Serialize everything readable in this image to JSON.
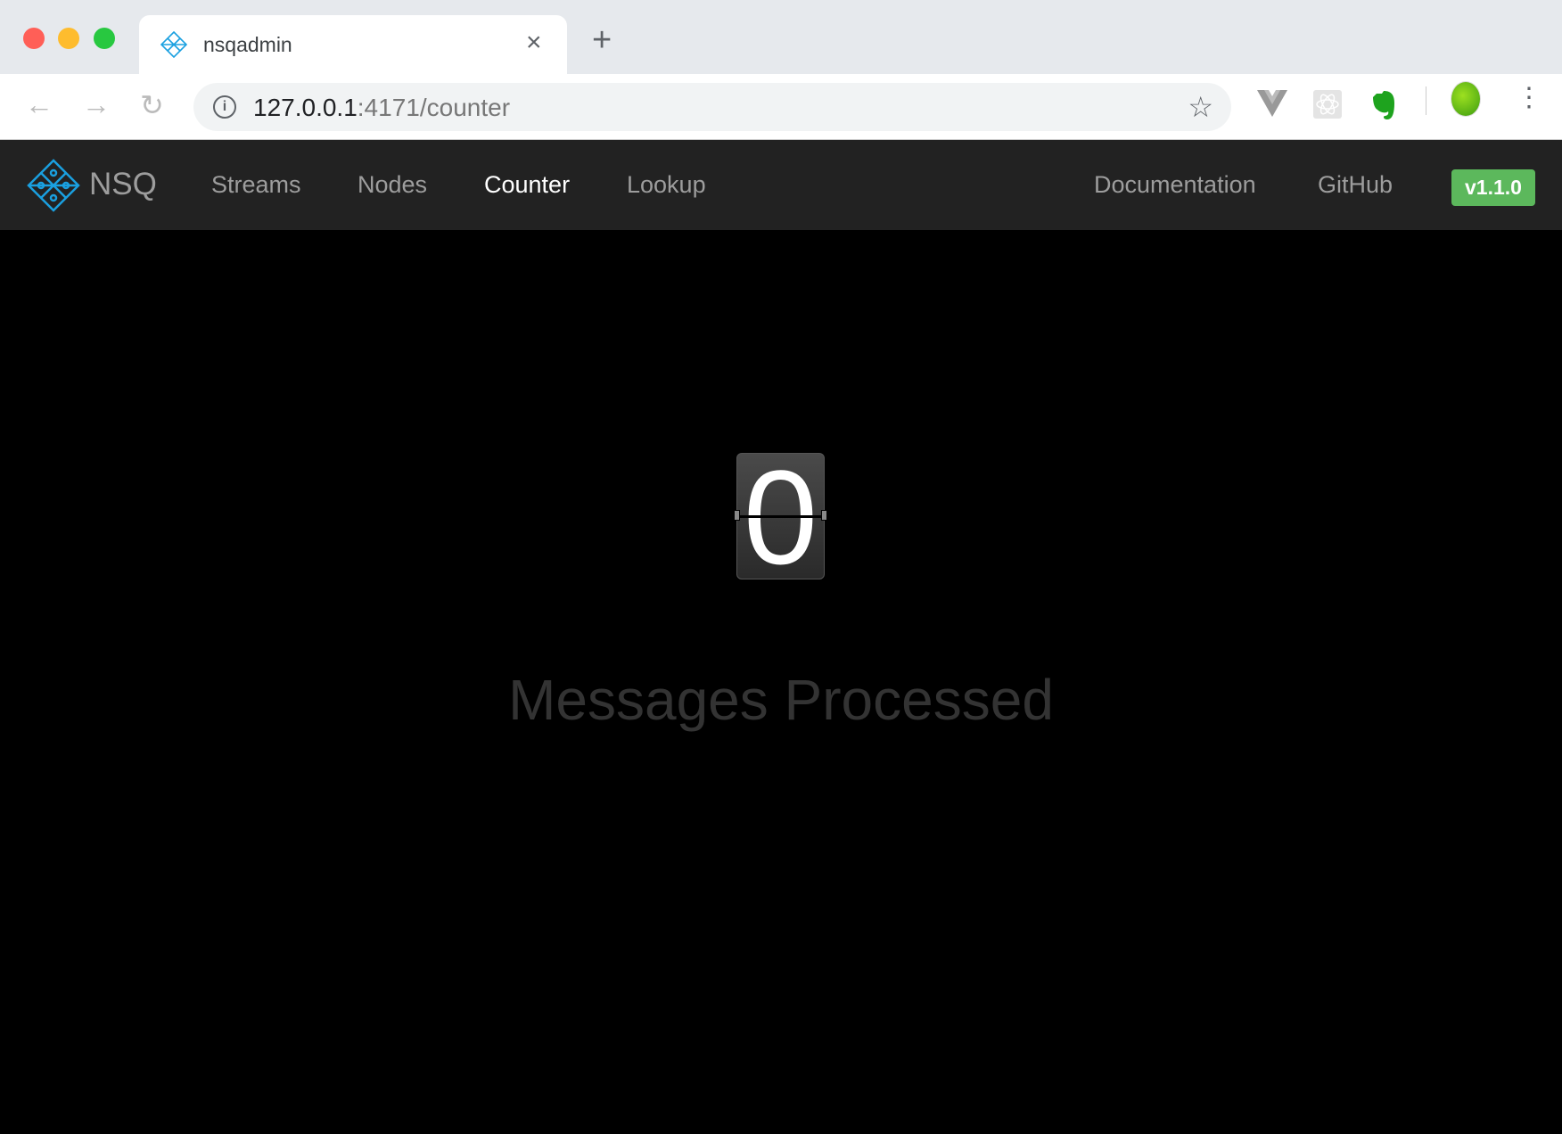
{
  "browser": {
    "tab_title": "nsqadmin",
    "close_glyph": "×",
    "new_tab_glyph": "+",
    "url_host": "127.0.0.1",
    "url_rest": ":4171/counter",
    "extensions": [
      "vue-devtools-icon",
      "react-devtools-icon",
      "evernote-icon"
    ],
    "traffic_lights": [
      "#ff5f57",
      "#febc2e",
      "#28c840"
    ]
  },
  "navbar": {
    "brand": "NSQ",
    "links": [
      {
        "label": "Streams"
      },
      {
        "label": "Nodes"
      },
      {
        "label": "Counter",
        "active": true
      },
      {
        "label": "Lookup"
      }
    ],
    "right_links": [
      {
        "label": "Documentation"
      },
      {
        "label": "GitHub"
      }
    ],
    "version": "v1.1.0",
    "accent": "#1aa0e0",
    "badge_color": "#5cb85c"
  },
  "counter": {
    "digits": [
      "0"
    ],
    "caption": "Messages Processed"
  }
}
